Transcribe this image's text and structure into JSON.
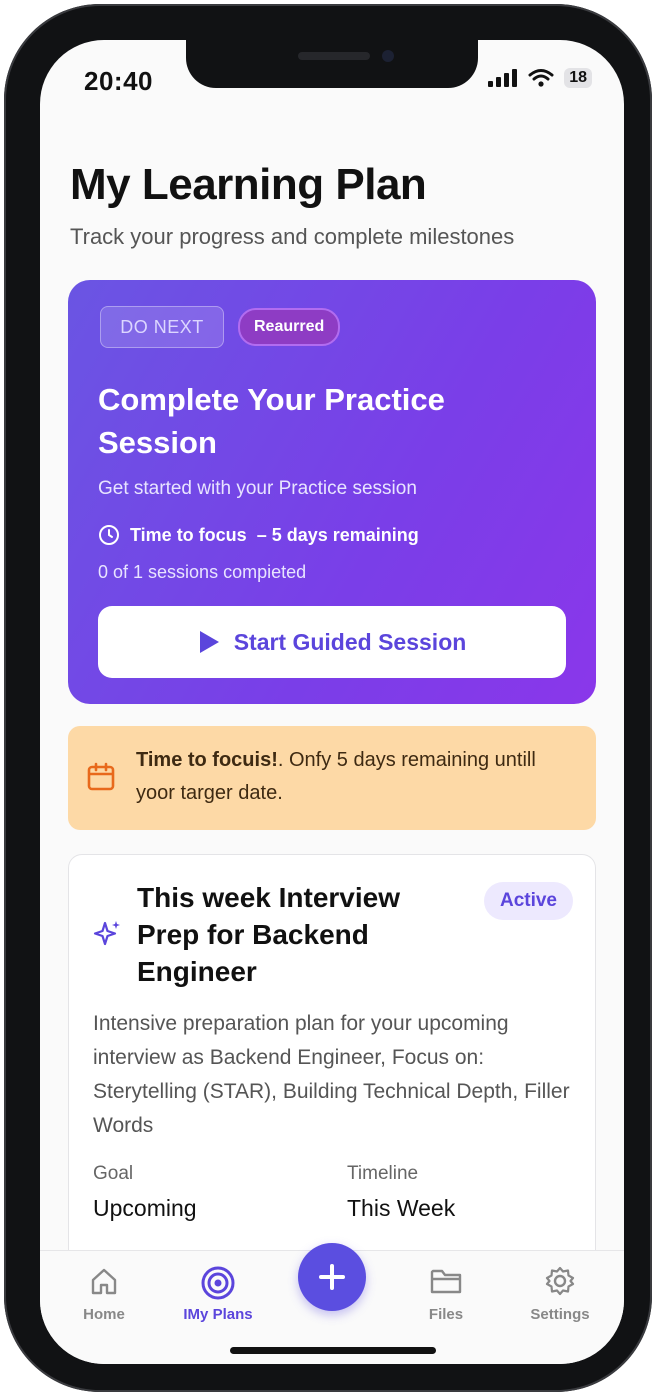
{
  "status_bar": {
    "time": "20:40",
    "battery": "18"
  },
  "header": {
    "title": "My Learning Plan",
    "subtitle": "Track your progress and complete milestones"
  },
  "hero": {
    "chip_label": "DO NEXT",
    "badge_label": "Reaurred",
    "title": "Complete Your Practice Session",
    "description": "Get started with your Practice session",
    "focus_label": "Time to focus",
    "focus_remaining": "– 5 days remaining",
    "sessions_progress": "0 of 1 sessions compieted",
    "start_button": "Start Guided Session",
    "colors": {
      "gradient_start": "#6a55e3",
      "gradient_end": "#8a37ea"
    }
  },
  "alert": {
    "bold": "Time to focuis!",
    "text": ". Onfy 5 days remaining untill yoor targer date.",
    "icon": "calendar-icon",
    "color": "#fdd9a6"
  },
  "plan": {
    "title": "This week Interview Prep for Backend Engineer",
    "badge": "Active",
    "description": "Intensive preparation plan for your upcoming interview as Backend Engineer, Focus on: Sterytelling (STAR), Building Technical Depth, Filler Words",
    "goal_label": "Goal",
    "goal_value": "Upcoming",
    "timeline_label": "Timeline",
    "timeline_value": "This Week"
  },
  "tabbar": {
    "items": [
      {
        "label": "Home",
        "icon": "home-icon"
      },
      {
        "label": "IMy Plans",
        "icon": "target-icon"
      },
      {
        "label": "Files",
        "icon": "folder-icon"
      },
      {
        "label": "Settings",
        "icon": "gear-icon"
      }
    ],
    "fab_icon": "plus-icon",
    "accent": "#5b45dc"
  }
}
